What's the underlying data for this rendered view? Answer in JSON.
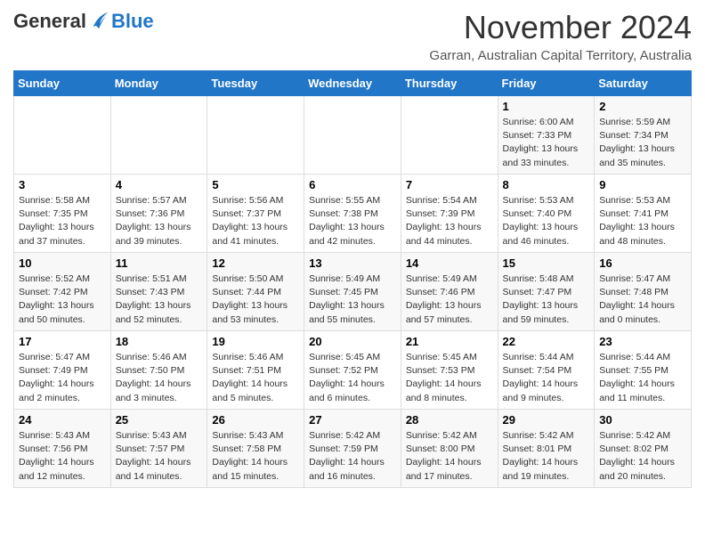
{
  "header": {
    "logo_general": "General",
    "logo_blue": "Blue",
    "month_title": "November 2024",
    "location": "Garran, Australian Capital Territory, Australia"
  },
  "days_of_week": [
    "Sunday",
    "Monday",
    "Tuesday",
    "Wednesday",
    "Thursday",
    "Friday",
    "Saturday"
  ],
  "weeks": [
    [
      {
        "num": "",
        "info": ""
      },
      {
        "num": "",
        "info": ""
      },
      {
        "num": "",
        "info": ""
      },
      {
        "num": "",
        "info": ""
      },
      {
        "num": "",
        "info": ""
      },
      {
        "num": "1",
        "info": "Sunrise: 6:00 AM\nSunset: 7:33 PM\nDaylight: 13 hours\nand 33 minutes."
      },
      {
        "num": "2",
        "info": "Sunrise: 5:59 AM\nSunset: 7:34 PM\nDaylight: 13 hours\nand 35 minutes."
      }
    ],
    [
      {
        "num": "3",
        "info": "Sunrise: 5:58 AM\nSunset: 7:35 PM\nDaylight: 13 hours\nand 37 minutes."
      },
      {
        "num": "4",
        "info": "Sunrise: 5:57 AM\nSunset: 7:36 PM\nDaylight: 13 hours\nand 39 minutes."
      },
      {
        "num": "5",
        "info": "Sunrise: 5:56 AM\nSunset: 7:37 PM\nDaylight: 13 hours\nand 41 minutes."
      },
      {
        "num": "6",
        "info": "Sunrise: 5:55 AM\nSunset: 7:38 PM\nDaylight: 13 hours\nand 42 minutes."
      },
      {
        "num": "7",
        "info": "Sunrise: 5:54 AM\nSunset: 7:39 PM\nDaylight: 13 hours\nand 44 minutes."
      },
      {
        "num": "8",
        "info": "Sunrise: 5:53 AM\nSunset: 7:40 PM\nDaylight: 13 hours\nand 46 minutes."
      },
      {
        "num": "9",
        "info": "Sunrise: 5:53 AM\nSunset: 7:41 PM\nDaylight: 13 hours\nand 48 minutes."
      }
    ],
    [
      {
        "num": "10",
        "info": "Sunrise: 5:52 AM\nSunset: 7:42 PM\nDaylight: 13 hours\nand 50 minutes."
      },
      {
        "num": "11",
        "info": "Sunrise: 5:51 AM\nSunset: 7:43 PM\nDaylight: 13 hours\nand 52 minutes."
      },
      {
        "num": "12",
        "info": "Sunrise: 5:50 AM\nSunset: 7:44 PM\nDaylight: 13 hours\nand 53 minutes."
      },
      {
        "num": "13",
        "info": "Sunrise: 5:49 AM\nSunset: 7:45 PM\nDaylight: 13 hours\nand 55 minutes."
      },
      {
        "num": "14",
        "info": "Sunrise: 5:49 AM\nSunset: 7:46 PM\nDaylight: 13 hours\nand 57 minutes."
      },
      {
        "num": "15",
        "info": "Sunrise: 5:48 AM\nSunset: 7:47 PM\nDaylight: 13 hours\nand 59 minutes."
      },
      {
        "num": "16",
        "info": "Sunrise: 5:47 AM\nSunset: 7:48 PM\nDaylight: 14 hours\nand 0 minutes."
      }
    ],
    [
      {
        "num": "17",
        "info": "Sunrise: 5:47 AM\nSunset: 7:49 PM\nDaylight: 14 hours\nand 2 minutes."
      },
      {
        "num": "18",
        "info": "Sunrise: 5:46 AM\nSunset: 7:50 PM\nDaylight: 14 hours\nand 3 minutes."
      },
      {
        "num": "19",
        "info": "Sunrise: 5:46 AM\nSunset: 7:51 PM\nDaylight: 14 hours\nand 5 minutes."
      },
      {
        "num": "20",
        "info": "Sunrise: 5:45 AM\nSunset: 7:52 PM\nDaylight: 14 hours\nand 6 minutes."
      },
      {
        "num": "21",
        "info": "Sunrise: 5:45 AM\nSunset: 7:53 PM\nDaylight: 14 hours\nand 8 minutes."
      },
      {
        "num": "22",
        "info": "Sunrise: 5:44 AM\nSunset: 7:54 PM\nDaylight: 14 hours\nand 9 minutes."
      },
      {
        "num": "23",
        "info": "Sunrise: 5:44 AM\nSunset: 7:55 PM\nDaylight: 14 hours\nand 11 minutes."
      }
    ],
    [
      {
        "num": "24",
        "info": "Sunrise: 5:43 AM\nSunset: 7:56 PM\nDaylight: 14 hours\nand 12 minutes."
      },
      {
        "num": "25",
        "info": "Sunrise: 5:43 AM\nSunset: 7:57 PM\nDaylight: 14 hours\nand 14 minutes."
      },
      {
        "num": "26",
        "info": "Sunrise: 5:43 AM\nSunset: 7:58 PM\nDaylight: 14 hours\nand 15 minutes."
      },
      {
        "num": "27",
        "info": "Sunrise: 5:42 AM\nSunset: 7:59 PM\nDaylight: 14 hours\nand 16 minutes."
      },
      {
        "num": "28",
        "info": "Sunrise: 5:42 AM\nSunset: 8:00 PM\nDaylight: 14 hours\nand 17 minutes."
      },
      {
        "num": "29",
        "info": "Sunrise: 5:42 AM\nSunset: 8:01 PM\nDaylight: 14 hours\nand 19 minutes."
      },
      {
        "num": "30",
        "info": "Sunrise: 5:42 AM\nSunset: 8:02 PM\nDaylight: 14 hours\nand 20 minutes."
      }
    ]
  ]
}
